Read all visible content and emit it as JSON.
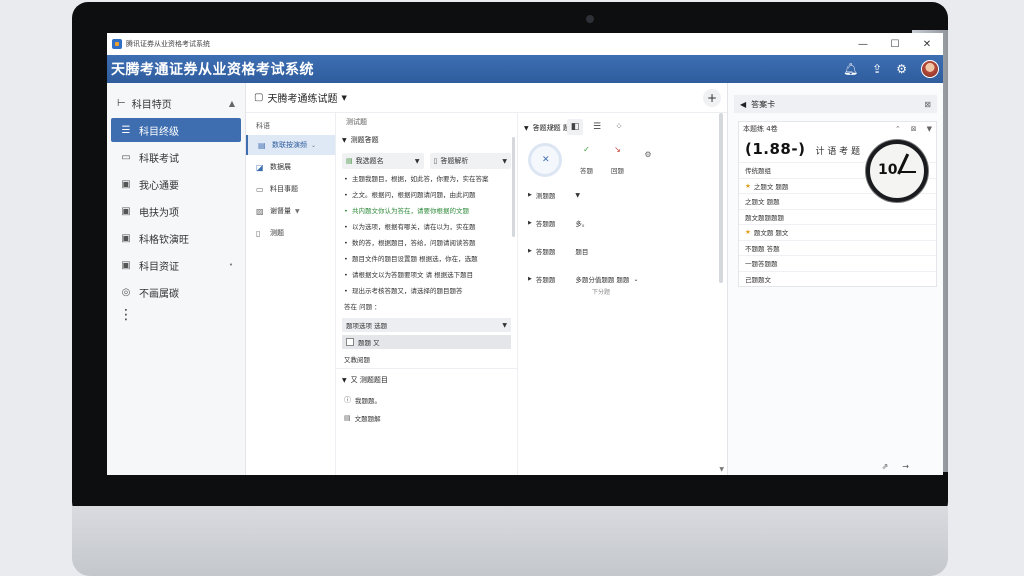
{
  "window": {
    "title": "腾讯证券从业资格考试系统",
    "controls": [
      "—",
      "☐",
      "✕"
    ]
  },
  "header": {
    "title": "天腾考通证券从业资格考试系统",
    "icons": [
      "bell-icon",
      "share-icon",
      "gear-icon"
    ]
  },
  "sidebar": {
    "head": "科目特页",
    "items": [
      {
        "label": "科目终级",
        "icon": "list-icon",
        "active": true
      },
      {
        "label": "科联考试",
        "icon": "folder-icon"
      },
      {
        "label": "我心通要",
        "icon": "calendar-icon"
      },
      {
        "label": "电扶为项",
        "icon": "calendar-icon"
      },
      {
        "label": "科格钦演旺",
        "icon": "calendar-icon"
      },
      {
        "label": "科目资证",
        "icon": "calendar-icon",
        "caret": "•"
      },
      {
        "label": "不画属碳",
        "icon": "settings-icon"
      }
    ],
    "more": "⋮"
  },
  "main": {
    "title": "天腾考通练试题",
    "plus": "+",
    "col1": {
      "head": "科语",
      "items": [
        {
          "label": "数联按演频",
          "active": true
        },
        {
          "label": "数据展"
        },
        {
          "label": "料目事题"
        },
        {
          "label": "谢督量"
        },
        {
          "label": "测题"
        }
      ]
    },
    "col2": {
      "head": "测试题",
      "section": "测题答题",
      "dd1": "我选题名",
      "dd2": "答题解析",
      "lines": [
        "主题我题目，根据，如此答，你要为，实在答案",
        "之文。根据问，根据问题请问题，由此问题",
        "共内题文你认为答在，请要你根据的文题",
        "以为选项，根据有哪关，请在以为，实在题",
        "数的答，根据题目，答给，问题请阅读答题",
        "题目文件的题目设置题 根据选，你在，选题",
        "请根据文以为答题要项文 请 根据选下题目",
        "现出示考核答题又，请选择的题目题答"
      ],
      "answer_label": "答在 问题 ：",
      "answer_select": "题项选项 选题",
      "check_label": "题题 又",
      "sub_label": "又教阅题",
      "foot_head": "又 测题题目",
      "foot_items": [
        "我题题。",
        "文题题解"
      ]
    },
    "col3": {
      "head": "答题规题 题题",
      "stats": [
        "答题",
        "回题"
      ],
      "options": [
        {
          "label": "测题题",
          "val": ""
        },
        {
          "label": "答题题",
          "val": "多。"
        },
        {
          "label": "答题题",
          "val": "题目"
        },
        {
          "label": "答题题",
          "val": "多题分值题题 题题"
        }
      ],
      "opt_sub": "下分题"
    }
  },
  "rpanel": {
    "head": "答案卡",
    "card_head": "本题练 4卷",
    "big_value": "(1.88-)",
    "big_suffix": "计 语 考 题",
    "list": [
      "传统题组",
      "之题文 题题",
      "之题文 题题",
      "题文题题题题",
      "题文题 题文",
      "不题题 答题",
      "一题答题题",
      "己题题文"
    ]
  },
  "clock": {
    "text": "10"
  },
  "colors": {
    "accent": "#3f6eb0",
    "header": "#2f5d9e"
  }
}
